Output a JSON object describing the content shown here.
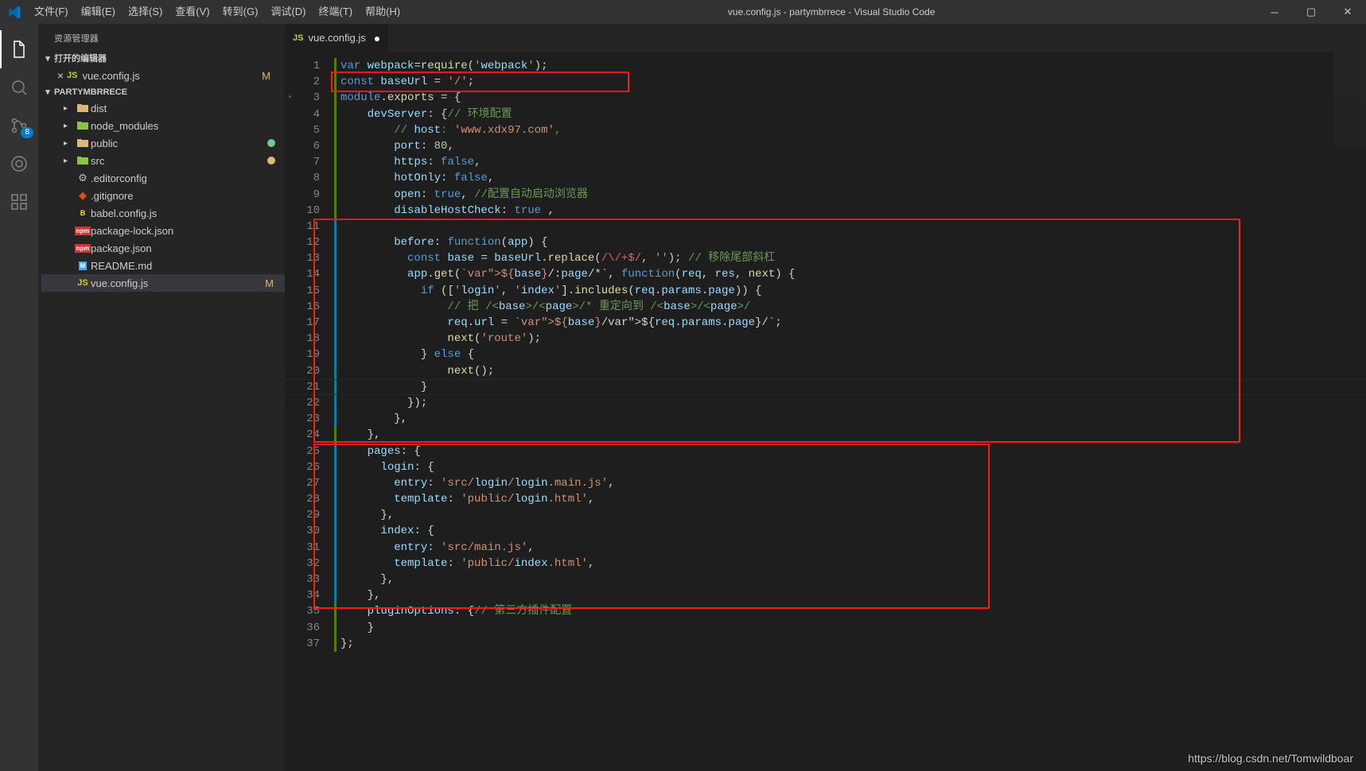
{
  "window": {
    "title": "vue.config.js - partymbrrece - Visual Studio Code"
  },
  "menu": [
    "文件(F)",
    "编辑(E)",
    "选择(S)",
    "查看(V)",
    "转到(G)",
    "调试(D)",
    "终端(T)",
    "帮助(H)"
  ],
  "activitybar": {
    "scm_badge": "8"
  },
  "sidebar": {
    "title": "资源管理器",
    "open_editors_label": "打开的编辑器",
    "open_editor_file": "vue.config.js",
    "open_editor_status": "M",
    "project_label": "PARTYMBRRECE",
    "tree": [
      {
        "type": "folder",
        "name": "dist"
      },
      {
        "type": "folder",
        "name": "node_modules"
      },
      {
        "type": "folder",
        "name": "public",
        "dot": "g"
      },
      {
        "type": "folder",
        "name": "src",
        "dot": "y"
      },
      {
        "type": "file",
        "name": ".editorconfig",
        "icon": "gear"
      },
      {
        "type": "file",
        "name": ".gitignore",
        "icon": "git"
      },
      {
        "type": "file",
        "name": "babel.config.js",
        "icon": "babel"
      },
      {
        "type": "file",
        "name": "package-lock.json",
        "icon": "npm"
      },
      {
        "type": "file",
        "name": "package.json",
        "icon": "npm"
      },
      {
        "type": "file",
        "name": "README.md",
        "icon": "md"
      },
      {
        "type": "file",
        "name": "vue.config.js",
        "icon": "js",
        "status": "M",
        "selected": true
      }
    ]
  },
  "tab": {
    "name": "vue.config.js"
  },
  "code_lines": [
    "var webpack=require('webpack');",
    "const baseUrl = '/';",
    "module.exports = {",
    "    devServer: {// 环境配置",
    "        // host: 'www.xdx97.com',",
    "        port: 80,",
    "        https: false,",
    "        hotOnly: false,",
    "        open: true, //配置自动启动浏览器",
    "        disableHostCheck: true ,",
    "",
    "        before: function(app) {",
    "          const base = baseUrl.replace(/\\/+$/, ''); // 移除尾部斜杠",
    "          app.get(`${base}/:page/*`, function(req, res, next) {",
    "            if (['login', 'index'].includes(req.params.page)) {",
    "                // 把 /<base>/<page>/* 重定向到 /<base>/<page>/",
    "                req.url = `${base}/${req.params.page}/`;",
    "                next('route');",
    "            } else {",
    "                next();",
    "            }",
    "          });",
    "        },",
    "    },",
    "    pages: {",
    "      login: {",
    "        entry: 'src/login/login.main.js',",
    "        template: 'public/login.html',",
    "      },",
    "      index: {",
    "        entry: 'src/main.js',",
    "        template: 'public/index.html',",
    "      },",
    "    },",
    "    pluginOptions: {// 第三方插件配置",
    "    }",
    "};"
  ],
  "watermark": "https://blog.csdn.net/Tomwildboar"
}
